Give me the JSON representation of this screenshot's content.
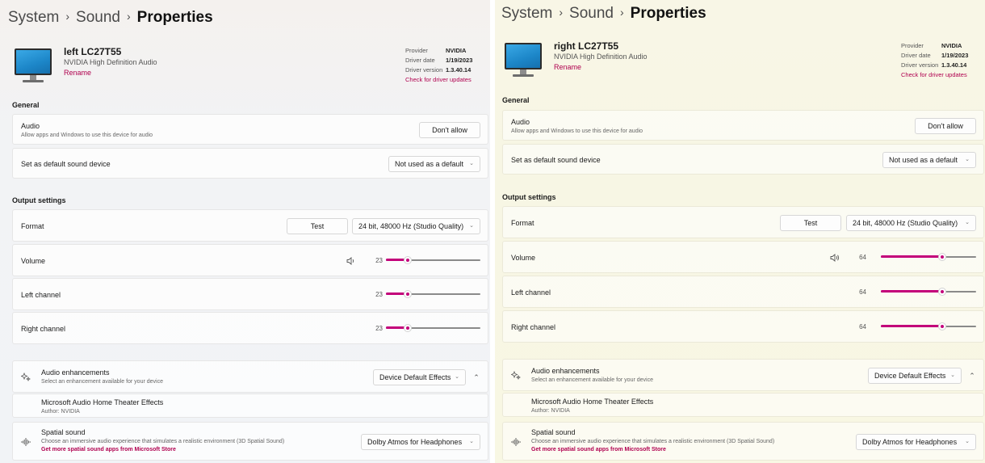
{
  "breadcrumb": {
    "system": "System",
    "sound": "Sound",
    "current": "Properties",
    "sep": "›"
  },
  "device_info": {
    "provider_label": "Provider",
    "provider": "NVIDIA",
    "driver_date_label": "Driver date",
    "driver_date": "1/19/2023",
    "driver_version_label": "Driver version",
    "driver_version": "1.3.40.14",
    "check_updates": "Check for driver updates"
  },
  "general": {
    "title": "General",
    "audio_label": "Audio",
    "audio_desc": "Allow apps and Windows to use this device for audio",
    "dont_allow": "Don't allow",
    "default_label": "Set as default sound device",
    "default_value": "Not used as a default"
  },
  "output": {
    "title": "Output settings",
    "format_label": "Format",
    "test_label": "Test",
    "format_value": "24 bit, 48000 Hz (Studio Quality)",
    "volume_label": "Volume",
    "left_label": "Left channel",
    "right_label": "Right channel"
  },
  "enhancements": {
    "title": "Audio enhancements",
    "desc": "Select an enhancement available for your device",
    "value": "Device Default Effects",
    "item_title": "Microsoft Audio Home Theater Effects",
    "item_author": "Author: NVIDIA"
  },
  "spatial": {
    "title": "Spatial sound",
    "desc": "Choose an immersive audio experience that simulates a realistic environment (3D Spatial Sound)",
    "link": "Get more spatial sound apps from Microsoft Store",
    "value": "Dolby Atmos for Headphones"
  },
  "panels": [
    {
      "device_name": "left LC27T55",
      "device_sub": "NVIDIA High Definition Audio",
      "rename": "Rename",
      "volume": 23,
      "left_channel": 23,
      "right_channel": 23
    },
    {
      "device_name": "right LC27T55",
      "device_sub": "NVIDIA High Definition Audio",
      "rename": "Rename",
      "volume": 64,
      "left_channel": 64,
      "right_channel": 64
    }
  ],
  "colors": {
    "accent": "#c3007a",
    "link": "#b0004f"
  },
  "icons": {
    "speaker": "speaker-icon",
    "enhance": "sparkle-icon",
    "spatial": "spatial-sound-icon"
  }
}
